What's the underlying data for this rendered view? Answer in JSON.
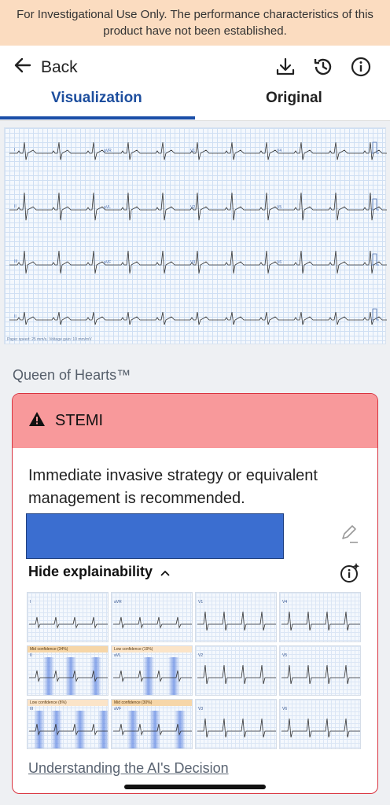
{
  "banner": {
    "text": "For Investigational Use Only. The performance characteristics of this product have not been established."
  },
  "nav": {
    "back_label": "Back"
  },
  "tabs": {
    "visualization": "Visualization",
    "original": "Original"
  },
  "ecg": {
    "caption": "Paper speed: 25 mm/s, Voltage gain: 10 mm/mV",
    "row_labels": [
      "I",
      "II",
      "III",
      "II"
    ],
    "lead_labels": [
      "aVR",
      "V1",
      "V4",
      "aVL",
      "V2",
      "V5",
      "aVF",
      "V3",
      "V6"
    ]
  },
  "section": {
    "title": "Queen of Hearts™"
  },
  "alert": {
    "label": "STEMI",
    "recommendation": "Immediate invasive strategy or equivalent management is recommended.",
    "explain_label": "Hide explainability",
    "link": "Understanding the AI's Decision",
    "accent_color": "#d9333f",
    "header_color": "#f8999b"
  },
  "thumbs": [
    {
      "lead": "I",
      "badge": ""
    },
    {
      "lead": "aVR",
      "badge": ""
    },
    {
      "lead": "V1",
      "badge": ""
    },
    {
      "lead": "V4",
      "badge": ""
    },
    {
      "lead": "II",
      "badge": "Mid confidence (34%)"
    },
    {
      "lead": "aVL",
      "badge": "Low confidence (19%)"
    },
    {
      "lead": "V2",
      "badge": ""
    },
    {
      "lead": "V5",
      "badge": ""
    },
    {
      "lead": "III",
      "badge": "Low confidence (8%)"
    },
    {
      "lead": "aVF",
      "badge": "Mid confidence (30%)"
    },
    {
      "lead": "V3",
      "badge": ""
    },
    {
      "lead": "V6",
      "badge": ""
    }
  ]
}
